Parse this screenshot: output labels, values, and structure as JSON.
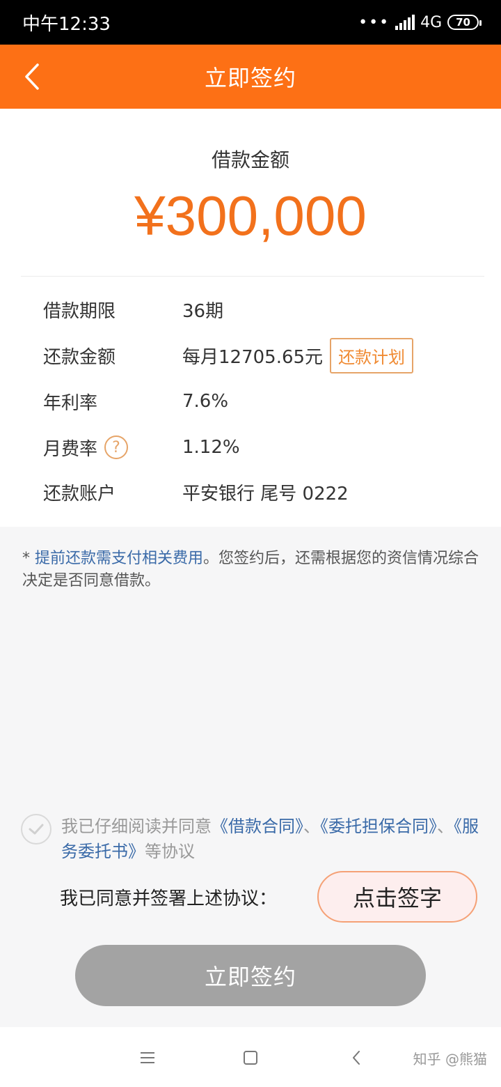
{
  "status_bar": {
    "time": "中午12:33",
    "dots": "•••",
    "network": "4G",
    "battery": "70"
  },
  "nav": {
    "title": "立即签约",
    "back_icon": "chevron-left-icon"
  },
  "loan": {
    "amount_label": "借款金额",
    "amount_value": "¥300,000"
  },
  "details": {
    "term_label": "借款期限",
    "term_value": "36期",
    "repay_label": "还款金额",
    "repay_value": "每月12705.65元",
    "repay_plan_button": "还款计划",
    "annual_rate_label": "年利率",
    "annual_rate_value": "7.6%",
    "monthly_fee_label": "月费率",
    "monthly_fee_value": "1.12%",
    "account_label": "还款账户",
    "account_value": "平安银行 尾号 0222"
  },
  "notice": {
    "prefix": "* ",
    "link": "提前还款需支付相关费用",
    "text": "。您签约后，还需根据您的资信情况综合决定是否同意借款。"
  },
  "agreement": {
    "prefix": "我已仔细阅读并同意",
    "doc1": "《借款合同》",
    "sep1": "、",
    "doc2": "《委托担保合同》",
    "sep2": "、",
    "doc3": "《服务委托书》",
    "suffix": "等协议"
  },
  "sign": {
    "label": "我已同意并签署上述协议：",
    "button": "点击签字"
  },
  "submit_button": "立即签约",
  "watermark": "知乎 @熊猫",
  "colors": {
    "brand": "#fd7015",
    "amount": "#f2711c",
    "link": "#3a6aa8",
    "disabled_button": "#a3a3a3"
  }
}
